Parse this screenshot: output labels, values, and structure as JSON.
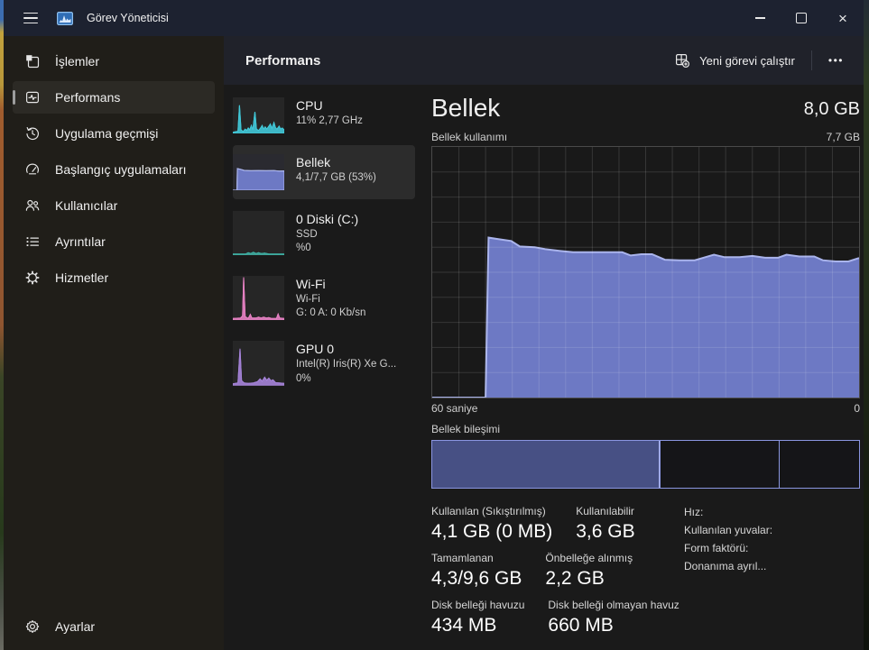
{
  "window": {
    "title": "Görev Yöneticisi",
    "close_glyph": "×"
  },
  "sidebar": {
    "items": [
      {
        "label": "İşlemler"
      },
      {
        "label": "Performans",
        "selected": true
      },
      {
        "label": "Uygulama geçmişi"
      },
      {
        "label": "Başlangıç uygulamaları"
      },
      {
        "label": "Kullanıcılar"
      },
      {
        "label": "Ayrıntılar"
      },
      {
        "label": "Hizmetler"
      }
    ],
    "footer_label": "Ayarlar"
  },
  "header": {
    "title": "Performans",
    "run_new_task_label": "Yeni görevi çalıştır",
    "more_glyph": "•••"
  },
  "devices": [
    {
      "name": "CPU",
      "line1": "11% 2,77 GHz",
      "line2": ""
    },
    {
      "name": "Bellek",
      "line1": "4,1/7,7 GB (53%)",
      "line2": "",
      "selected": true
    },
    {
      "name": "0 Diski (C:)",
      "line1": "SSD",
      "line2": "%0"
    },
    {
      "name": "Wi-Fi",
      "line1": "Wi-Fi",
      "line2": "G: 0 A: 0 Kb/sn"
    },
    {
      "name": "GPU 0",
      "line1": "Intel(R) Iris(R) Xe G...",
      "line2": "0%"
    }
  ],
  "memory": {
    "title": "Bellek",
    "total": "8,0 GB",
    "usage_label": "Bellek kullanımı",
    "usage_max": "7,7 GB",
    "time_span": "60 saniye",
    "time_zero": "0",
    "composition_label": "Bellek bileşimi",
    "stats": [
      {
        "label": "Kullanılan (Sıkıştırılmış)",
        "value": "4,1 GB (0 MB)"
      },
      {
        "label": "Kullanılabilir",
        "value": "3,6 GB"
      },
      {
        "label": "Tamamlanan",
        "value": "4,3/9,6 GB"
      },
      {
        "label": "Önbelleğe alınmış",
        "value": "2,2 GB"
      },
      {
        "label": "Disk belleği havuzu",
        "value": "434 MB"
      },
      {
        "label": "Disk belleği olmayan havuz",
        "value": "660 MB"
      }
    ],
    "hw_info": [
      "Hız:",
      "Kullanılan yuvalar:",
      "Form faktörü:",
      "Donanıma ayrıl..."
    ]
  },
  "colors": {
    "memory_fill": "#6d79c4",
    "memory_stroke": "#aab4ec",
    "composition_border": "#8a95e0",
    "composition_used": "#475084",
    "cpu": "#41c8d8",
    "disk": "#3fb0a4",
    "wifi": "#e681c3",
    "gpu": "#a583d9"
  },
  "icons": {
    "titlebar": [
      "hamburger-icon",
      "app-icon",
      "minimize-icon",
      "maximize-icon",
      "close-icon"
    ],
    "header": [
      "new-task-icon",
      "more-options-icon"
    ],
    "sidebar": [
      "processes-icon",
      "performance-icon",
      "history-icon",
      "startup-icon",
      "users-icon",
      "details-icon",
      "services-icon",
      "gear-icon"
    ]
  },
  "chart_data": [
    {
      "id": "memory-usage",
      "type": "area",
      "title": "Bellek kullanımı",
      "x_axis": {
        "left_label": "60 saniye",
        "right_label": "0",
        "span_seconds": 60
      },
      "y_axis": {
        "min": 0,
        "max_gb": 7.7,
        "max_label": "7,7 GB"
      },
      "unit": "fraction of 7,7 GB",
      "fill": "#6d79c4",
      "stroke": "#aab4ec",
      "stroke_width": 2,
      "grid": {
        "cols": 16,
        "rows": 10,
        "color": "rgba(255,255,255,0.13)"
      },
      "points": [
        [
          0,
          0
        ],
        [
          0.125,
          0
        ],
        [
          0.132,
          0.638
        ],
        [
          0.155,
          0.632
        ],
        [
          0.185,
          0.625
        ],
        [
          0.205,
          0.603
        ],
        [
          0.24,
          0.6
        ],
        [
          0.265,
          0.592
        ],
        [
          0.3,
          0.585
        ],
        [
          0.33,
          0.58
        ],
        [
          0.37,
          0.58
        ],
        [
          0.41,
          0.58
        ],
        [
          0.445,
          0.58
        ],
        [
          0.465,
          0.567
        ],
        [
          0.49,
          0.572
        ],
        [
          0.515,
          0.572
        ],
        [
          0.545,
          0.55
        ],
        [
          0.58,
          0.548
        ],
        [
          0.615,
          0.548
        ],
        [
          0.635,
          0.558
        ],
        [
          0.66,
          0.57
        ],
        [
          0.685,
          0.56
        ],
        [
          0.72,
          0.56
        ],
        [
          0.75,
          0.565
        ],
        [
          0.78,
          0.558
        ],
        [
          0.81,
          0.558
        ],
        [
          0.83,
          0.57
        ],
        [
          0.86,
          0.563
        ],
        [
          0.895,
          0.563
        ],
        [
          0.915,
          0.548
        ],
        [
          0.945,
          0.543
        ],
        [
          0.975,
          0.543
        ],
        [
          1,
          0.557
        ]
      ]
    },
    {
      "id": "memory-composition",
      "type": "stacked-bar",
      "label": "Bellek bileşimi",
      "border": "#8a95e0",
      "segments": [
        {
          "name": "in-use",
          "fraction": 0.532,
          "fill": "#475084"
        },
        {
          "name": "standby",
          "fraction": 0.279,
          "fill": "none"
        },
        {
          "name": "free",
          "fraction": 0.189,
          "fill": "none"
        }
      ]
    },
    {
      "id": "cpu-mini",
      "type": "area",
      "fill": "#41c8d8",
      "fill_opacity": 0.9,
      "stroke": "#41c8d8",
      "stroke_width": 1,
      "outline": true,
      "points": [
        [
          0,
          0.03
        ],
        [
          0.06,
          0.05
        ],
        [
          0.1,
          0.06
        ],
        [
          0.13,
          0.78
        ],
        [
          0.16,
          0.1
        ],
        [
          0.2,
          0.05
        ],
        [
          0.24,
          0.12
        ],
        [
          0.27,
          0.08
        ],
        [
          0.3,
          0.15
        ],
        [
          0.33,
          0.1
        ],
        [
          0.36,
          0.22
        ],
        [
          0.39,
          0.1
        ],
        [
          0.43,
          0.6
        ],
        [
          0.46,
          0.12
        ],
        [
          0.5,
          0.08
        ],
        [
          0.54,
          0.15
        ],
        [
          0.57,
          0.22
        ],
        [
          0.6,
          0.12
        ],
        [
          0.63,
          0.18
        ],
        [
          0.66,
          0.12
        ],
        [
          0.7,
          0.2
        ],
        [
          0.73,
          0.26
        ],
        [
          0.76,
          0.14
        ],
        [
          0.8,
          0.3
        ],
        [
          0.83,
          0.16
        ],
        [
          0.86,
          0.12
        ],
        [
          0.9,
          0.2
        ],
        [
          0.93,
          0.12
        ],
        [
          0.96,
          0.15
        ],
        [
          1,
          0.1
        ]
      ]
    },
    {
      "id": "memory-mini",
      "type": "area",
      "fill": "#6d79c4",
      "fill_opacity": 1,
      "stroke": "#aab4ec",
      "stroke_width": 1.2,
      "outline": true,
      "points": [
        [
          0,
          0
        ],
        [
          0.08,
          0
        ],
        [
          0.09,
          0.6
        ],
        [
          0.15,
          0.58
        ],
        [
          0.22,
          0.55
        ],
        [
          0.35,
          0.54
        ],
        [
          0.5,
          0.545
        ],
        [
          0.65,
          0.54
        ],
        [
          0.8,
          0.545
        ],
        [
          0.9,
          0.53
        ],
        [
          1,
          0.535
        ]
      ]
    },
    {
      "id": "disk-mini",
      "type": "area",
      "fill": "#3fb0a4",
      "fill_opacity": 0.85,
      "stroke": "#3fb0a4",
      "stroke_width": 1,
      "outline": true,
      "points": [
        [
          0,
          0.03
        ],
        [
          0.25,
          0.03
        ],
        [
          0.3,
          0.06
        ],
        [
          0.35,
          0.04
        ],
        [
          0.4,
          0.07
        ],
        [
          0.45,
          0.04
        ],
        [
          0.5,
          0.06
        ],
        [
          0.55,
          0.04
        ],
        [
          0.62,
          0.05
        ],
        [
          0.7,
          0.03
        ],
        [
          1,
          0.03
        ]
      ]
    },
    {
      "id": "wifi-mini",
      "type": "area",
      "fill": "#e681c3",
      "fill_opacity": 0.9,
      "stroke": "#e681c3",
      "stroke_width": 1,
      "outline": true,
      "points": [
        [
          0,
          0.04
        ],
        [
          0.15,
          0.05
        ],
        [
          0.19,
          0.1
        ],
        [
          0.21,
          0.97
        ],
        [
          0.24,
          0.08
        ],
        [
          0.3,
          0.04
        ],
        [
          0.34,
          0.13
        ],
        [
          0.37,
          0.05
        ],
        [
          0.45,
          0.05
        ],
        [
          0.5,
          0.07
        ],
        [
          0.55,
          0.05
        ],
        [
          0.6,
          0.07
        ],
        [
          0.65,
          0.05
        ],
        [
          0.7,
          0.06
        ],
        [
          0.75,
          0.04
        ],
        [
          0.85,
          0.04
        ],
        [
          0.88,
          0.14
        ],
        [
          0.91,
          0.05
        ],
        [
          1,
          0.04
        ]
      ]
    },
    {
      "id": "gpu-mini",
      "type": "area",
      "fill": "#a583d9",
      "fill_opacity": 0.9,
      "stroke": "#a583d9",
      "stroke_width": 1,
      "outline": true,
      "points": [
        [
          0,
          0.03
        ],
        [
          0.1,
          0.05
        ],
        [
          0.14,
          0.82
        ],
        [
          0.17,
          0.1
        ],
        [
          0.22,
          0.05
        ],
        [
          0.3,
          0.04
        ],
        [
          0.4,
          0.05
        ],
        [
          0.48,
          0.08
        ],
        [
          0.53,
          0.14
        ],
        [
          0.57,
          0.09
        ],
        [
          0.62,
          0.18
        ],
        [
          0.66,
          0.11
        ],
        [
          0.7,
          0.16
        ],
        [
          0.74,
          0.1
        ],
        [
          0.78,
          0.12
        ],
        [
          0.83,
          0.06
        ],
        [
          0.9,
          0.05
        ],
        [
          1,
          0.04
        ]
      ]
    }
  ]
}
